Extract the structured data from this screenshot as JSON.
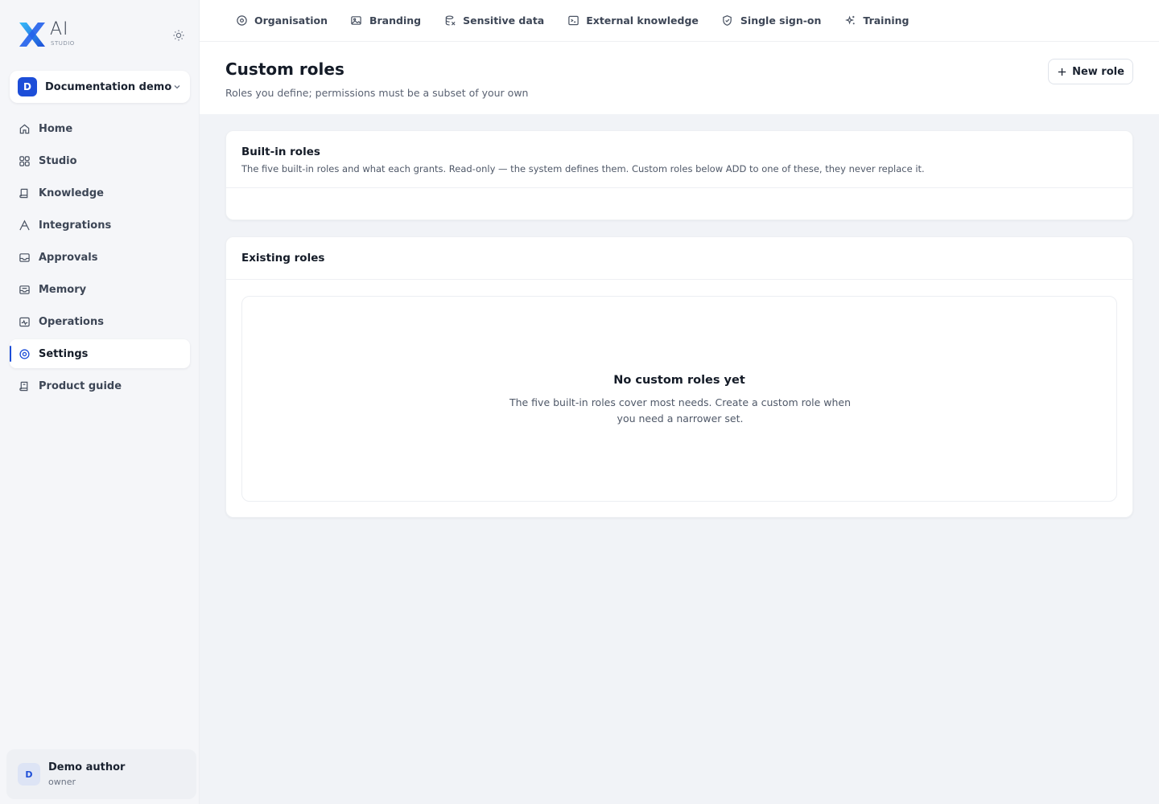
{
  "brand": {
    "name": "AI",
    "sub": "STUDIO"
  },
  "workspace": {
    "initial": "D",
    "name": "Documentation demo"
  },
  "nav": [
    {
      "label": "Home",
      "icon": "home-icon"
    },
    {
      "label": "Studio",
      "icon": "grid-icon"
    },
    {
      "label": "Knowledge",
      "icon": "book-icon"
    },
    {
      "label": "Integrations",
      "icon": "integrations-icon"
    },
    {
      "label": "Approvals",
      "icon": "inbox-icon"
    },
    {
      "label": "Memory",
      "icon": "memory-icon"
    },
    {
      "label": "Operations",
      "icon": "activity-icon"
    },
    {
      "label": "Settings",
      "icon": "gear-icon",
      "active": true
    },
    {
      "label": "Product guide",
      "icon": "guide-icon"
    }
  ],
  "user": {
    "initial": "D",
    "name": "Demo author",
    "role": "owner"
  },
  "tabs": [
    {
      "label": "Organisation",
      "icon": "organisation-icon"
    },
    {
      "label": "Branding",
      "icon": "image-icon"
    },
    {
      "label": "Sensitive data",
      "icon": "sensitive-data-icon"
    },
    {
      "label": "External knowledge",
      "icon": "terminal-icon"
    },
    {
      "label": "Single sign-on",
      "icon": "shield-icon"
    },
    {
      "label": "Training",
      "icon": "sparkle-icon"
    }
  ],
  "page": {
    "title": "Custom roles",
    "subtitle": "Roles you define; permissions must be a subset of your own",
    "new_role_label": "New role"
  },
  "builtin": {
    "title": "Built-in roles",
    "description": "The five built-in roles and what each grants. Read-only — the system defines them. Custom roles below ADD to one of these, they never replace it."
  },
  "existing": {
    "title": "Existing roles",
    "empty_title": "No custom roles yet",
    "empty_description": "The five built-in roles cover most needs. Create a custom role when you need a narrower set."
  },
  "colors": {
    "accent": "#1d4ed8",
    "background": "#f1f3f7"
  }
}
